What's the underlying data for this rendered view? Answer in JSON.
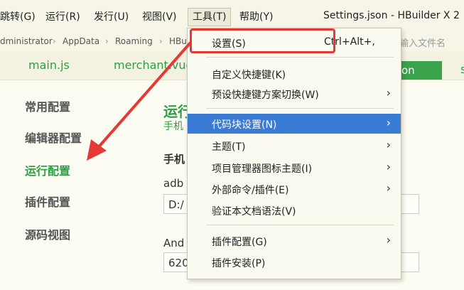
{
  "menubar": {
    "items": [
      "跳转(G)",
      "运行(R)",
      "发行(U)",
      "视图(V)",
      "工具(T)",
      "帮助(Y)"
    ],
    "active_index": 4
  },
  "window": {
    "title": "Settings.json - HBuilder X 2"
  },
  "breadcrumb": {
    "items": [
      "dministrator",
      "AppData",
      "Roaming",
      "HBu"
    ],
    "file_search_placeholder": "输入文件名"
  },
  "tabs": {
    "items": [
      "main.js",
      "merchant.vue"
    ],
    "active_label": "on",
    "partial": "s"
  },
  "sidebar": {
    "items": [
      "常用配置",
      "编辑器配置",
      "运行配置",
      "插件配置",
      "源码视图"
    ],
    "active_index": 2
  },
  "content": {
    "section_title": "运行",
    "section_sub": "手机",
    "phone_label": "手机",
    "adb_label": "adb",
    "adb_value": "D:/",
    "android_label": "And",
    "android_value": "620"
  },
  "tools_menu": {
    "items": [
      {
        "label": "设置(S)",
        "shortcut": "Ctrl+Alt+,"
      },
      {
        "label": "自定义快捷键(K)",
        "shortcut": ""
      },
      {
        "label": "预设快捷键方案切换(W)",
        "shortcut": ""
      },
      {
        "label": "代码块设置(N)",
        "shortcut": ""
      },
      {
        "label": "主题(T)",
        "shortcut": ""
      },
      {
        "label": "项目管理器图标主题(I)",
        "shortcut": ""
      },
      {
        "label": "外部命令/插件(E)",
        "shortcut": ""
      },
      {
        "label": "验证本文档语法(V)",
        "shortcut": ""
      },
      {
        "label": "插件配置(G)",
        "shortcut": ""
      },
      {
        "label": "插件安装(P)",
        "shortcut": ""
      }
    ],
    "hover_index": 3
  },
  "colors": {
    "accent_green": "#2e9e47",
    "hover_blue": "#3a7bd5",
    "annotation_red": "#e53935"
  }
}
